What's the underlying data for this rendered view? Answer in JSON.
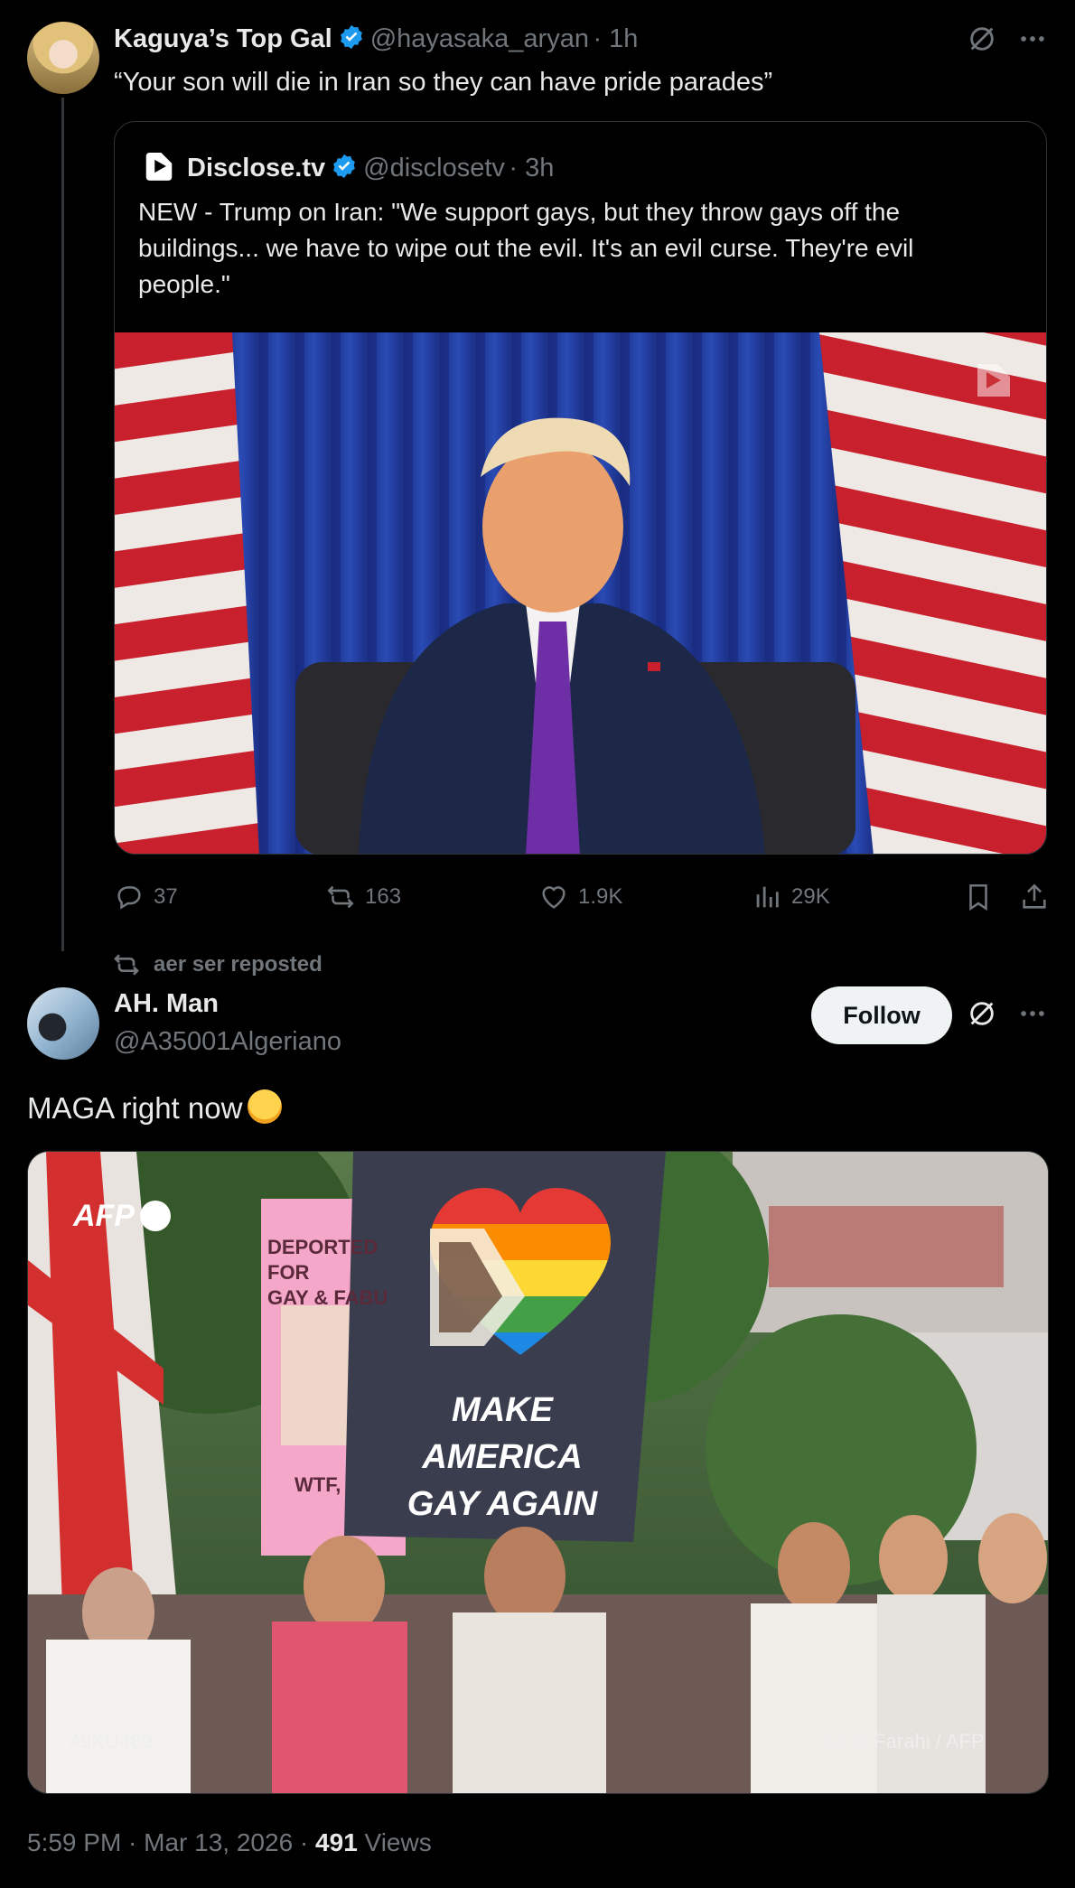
{
  "tweet1": {
    "display_name": "Kaguya’s Top Gal",
    "handle": "@hayasaka_aryan",
    "time": "· 1h",
    "text": "“Your son will die in Iran so they can have pride parades”"
  },
  "quote": {
    "display_name": "Disclose.tv",
    "handle": "@disclosetv",
    "time": "· 3h",
    "text": "NEW - Trump on Iran: \"We support gays, but they throw gays off the buildings... we have to wipe out the evil. It's an evil curse. They're evil people.\""
  },
  "actions": {
    "replies": "37",
    "reposts": "163",
    "likes": "1.9K",
    "views": "29K"
  },
  "repost": {
    "label": "aer ser reposted"
  },
  "tweet2": {
    "display_name": "AH. Man",
    "handle": "@A35001Algeriano",
    "follow_label": "Follow",
    "text": "MAGA right now",
    "image": {
      "agency": "AFP",
      "sign_text_line1": "MAKE AMERICA",
      "sign_text_line2": "GAY AGAIN",
      "pink_sign_line1": "DEPORTED FOR",
      "pink_sign_line2": "GAY & FABU",
      "pink_sign_line3": "WTF,",
      "image_id": "49KU489",
      "credit": "Amid Farahi / AFP"
    }
  },
  "footer": {
    "time": "5:59 PM · Mar 13, 2026 · ",
    "views": "491",
    "views_label": " Views"
  },
  "colors": {
    "background": "#000000",
    "text": "#e7e9ea",
    "muted": "#71767b",
    "verified": "#1d9bf0",
    "follow_bg": "#eff3f4"
  }
}
